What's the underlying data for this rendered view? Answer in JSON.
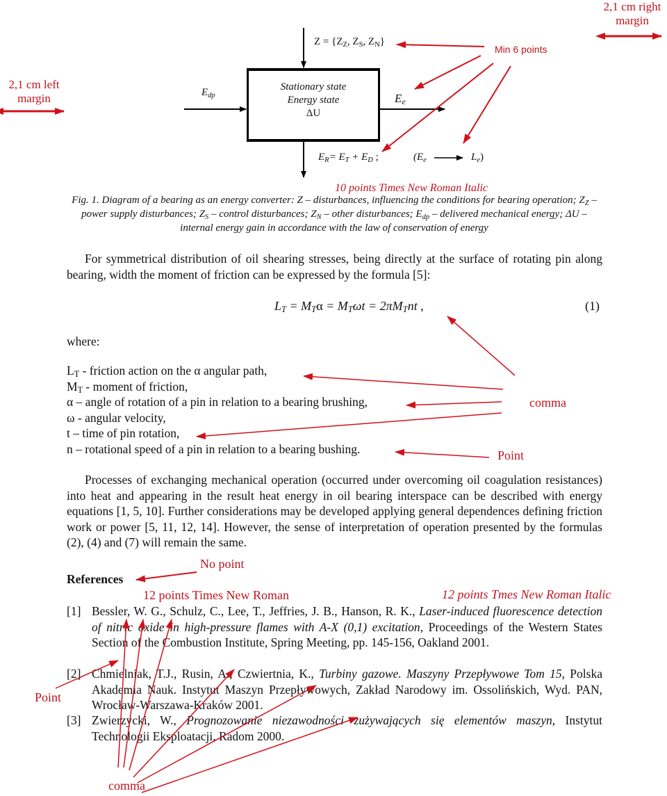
{
  "annotations": {
    "right_margin": "2,1 cm right margin",
    "left_margin": "2,1 cm left margin",
    "min_points": "Min 6 points",
    "caption_font": "10 points Times New Roman Italic",
    "comma_formula": "comma",
    "point_defs": "Point",
    "no_point": "No point",
    "refs_font_regular": "12 points Times New Roman",
    "refs_font_italic": "12 points Tmes New Roman Italic",
    "point_refs": "Point",
    "comma_refs": "comma",
    "color": "#c0141e"
  },
  "diagram": {
    "z_label": "Z = {Z",
    "z_sub1": "Z",
    "z_sep1": ", Z",
    "z_sub2": "S",
    "z_sep2": ", Z",
    "z_sub3": "N",
    "z_end": "}",
    "input_label": "E",
    "input_sub": "dp",
    "output_label": "E",
    "output_sub": "e",
    "box_line1": "Stationary state",
    "box_line2": "Energy state",
    "box_line3": "ΔU",
    "er_eq": {
      "a": "E",
      "a_sub": "R",
      "b": "= E",
      "b_sub": "T",
      "c": " + E",
      "c_sub": "D",
      "d": " ;"
    },
    "conv": {
      "open": "(E",
      "open_sub": "e",
      "to": "L",
      "to_sub": "e",
      "close": ")"
    }
  },
  "caption": {
    "p1": "Fig. 1. Diagram of a bearing as an energy converter: Z – disturbances, influencing the conditions for bearing operation; Z",
    "s1": "Z",
    "p2": " – power supply disturbances; Z",
    "s2": "S",
    "p3": " – control disturbances; Z",
    "s3": "N",
    "p4": " – other disturbances; E",
    "s4": "dp",
    "p5": " – delivered mechanical energy; ΔU – internal energy gain in accordance with the law of conservation of energy"
  },
  "paragraph1": "For symmetrical distribution of oil shearing stresses, being directly at the surface of rotating pin along bearing, width the moment of friction can be expressed by the formula [5]:",
  "formula": {
    "lt": "L",
    "lt_sub": "T",
    "eq1": " = M",
    "mt1_sub": "T",
    "alpha": "α",
    "eq2": " = M",
    "mt2_sub": "T",
    "omega_t": "ωt",
    "eq3": " = 2πM",
    "mt3_sub": "T",
    "nt": "nt",
    "tail": " ,",
    "number": "(1)"
  },
  "where_label": "where:",
  "definitions": [
    {
      "sym": "L",
      "sub": "T",
      "text": " - friction action on the α angular path,"
    },
    {
      "sym": "M",
      "sub": "T",
      "text": " - moment of friction,"
    },
    {
      "sym": "α",
      "sub": "",
      "text": " – angle of rotation of a pin in relation to a bearing brushing,"
    },
    {
      "sym": "ω",
      "sub": "",
      "text": " - angular velocity,"
    },
    {
      "sym": "t",
      "sub": "",
      "text": " – time of pin rotation,"
    },
    {
      "sym": "n",
      "sub": "",
      "text": " – rotational speed of a pin in relation to a bearing bushing."
    }
  ],
  "paragraph2": "Processes of exchanging mechanical operation (occurred under overcoming oil coagulation resistances) into heat and appearing in the result heat energy in oil bearing interspace can be described with energy equations [1, 5, 10]. Further considerations may be developed applying general dependences defining friction work or power [5, 11, 12, 14]. However, the sense of interpretation of operation presented by the formulas (2), (4) and (7) will remain the same.",
  "references_title": "References",
  "references": [
    {
      "num": "[1]",
      "authors": "Bessler, W. G., Schulz, C., Lee, T., Jeffries, J. B., Hanson, R. K., ",
      "title": "Laser-induced fluorescence detection of nitric oxide in high-pressure flames with A-X (0,1) excitation",
      "rest": ", Proceedings of the Western States Section of the Combustion Institute, Spring Meeting, pp. 145-156, Oakland 2001."
    },
    {
      "num": "[2]",
      "authors": "Chmielniak, T.J., Rusin, A., Czwiertnia, K., ",
      "title": "Turbiny gazowe. Maszyny Przepływowe Tom 15",
      "rest": ", Polska Akademia Nauk. Instytut Maszyn Przepływowych, Zakład Narodowy im. Ossolińskich, Wyd. PAN, Wrocław-Warszawa-Kraków 2001."
    },
    {
      "num": "[3]",
      "authors": "Zwierzycki, W., ",
      "title": "Prognozowanie niezawodności zużywających się elementów maszyn",
      "rest": ", Instytut Technologii Eksploatacji, Radom 2000."
    }
  ]
}
